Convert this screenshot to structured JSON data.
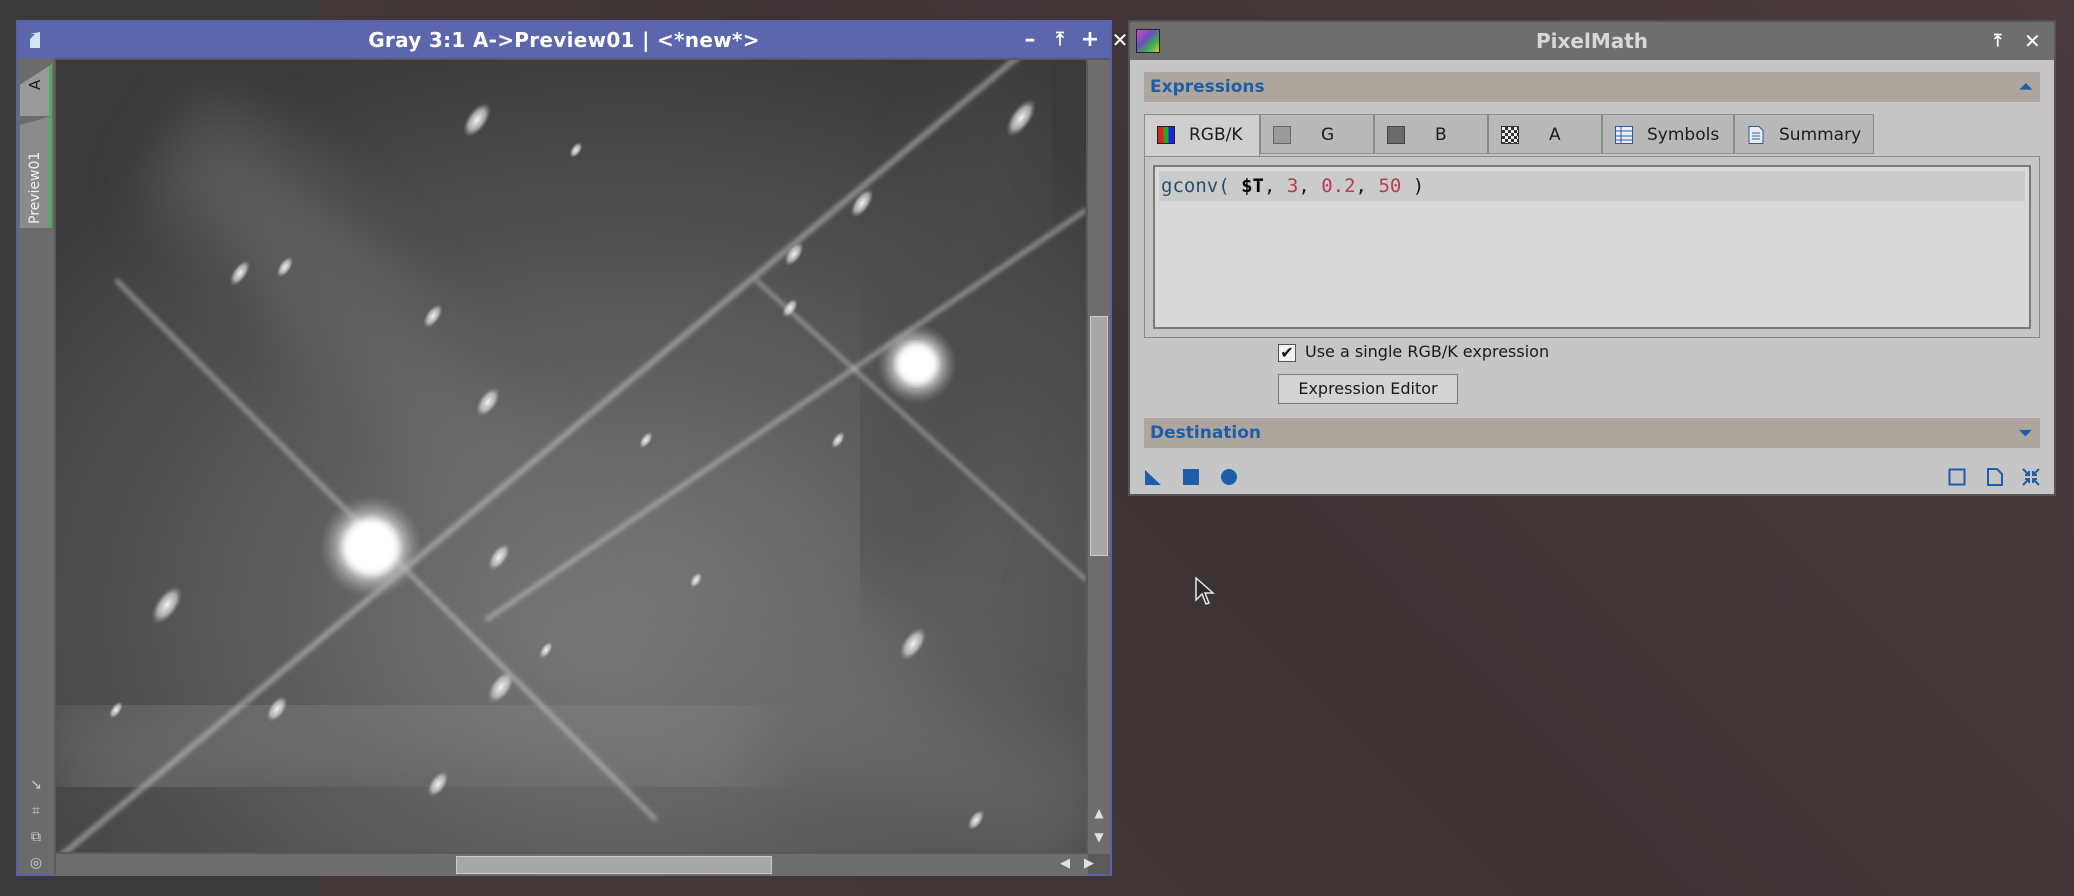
{
  "image_window": {
    "title": "Gray 3:1 A->Preview01 | <*new*>",
    "side_tabs": [
      "A",
      "Preview01"
    ],
    "buttons": {
      "minimize": "–",
      "shade": "⤒",
      "maximize": "+",
      "close": "✕"
    }
  },
  "pixelmath": {
    "title": "PixelMath",
    "sections": {
      "expressions": "Expressions",
      "destination": "Destination"
    },
    "tabs": [
      {
        "label": "RGB/K",
        "icon": "rgb-channels-icon",
        "active": true
      },
      {
        "label": "G",
        "icon": "gray-swatch-icon"
      },
      {
        "label": "B",
        "icon": "dark-swatch-icon"
      },
      {
        "label": "A",
        "icon": "alpha-checker-icon"
      },
      {
        "label": "Symbols",
        "icon": "table-icon"
      },
      {
        "label": "Summary",
        "icon": "document-icon"
      }
    ],
    "expression": {
      "fn": "gconv(",
      "arg1": "$T",
      "arg2": "3",
      "arg3": "0.2",
      "arg4": "50",
      "close": ")"
    },
    "single_expression_label": "Use a single RGB/K expression",
    "single_expression_checked": true,
    "expression_editor_label": "Expression Editor"
  },
  "colors": {
    "title_bar_active": "#5c66ad",
    "section_text": "#1d5ea8",
    "accent_tab": "#4fae5c"
  }
}
